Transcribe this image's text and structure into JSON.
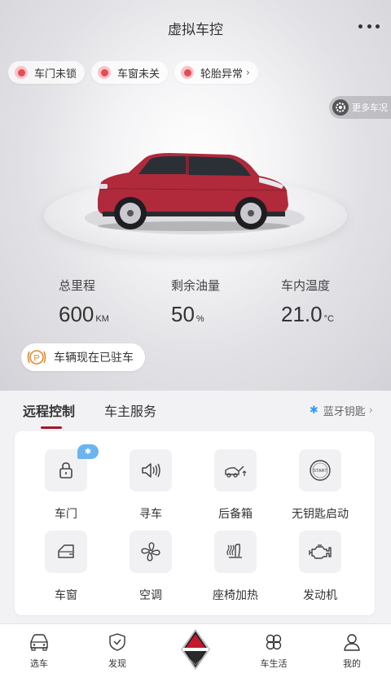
{
  "header": {
    "title": "虚拟车控"
  },
  "alerts": [
    {
      "label": "车门未锁"
    },
    {
      "label": "车窗未关"
    },
    {
      "label": "轮胎异常",
      "chevron": "›"
    }
  ],
  "more_status": {
    "label": "更多车况"
  },
  "stats": [
    {
      "label": "总里程",
      "value": "600",
      "unit": "KM"
    },
    {
      "label": "剩余油量",
      "value": "50",
      "unit": "%"
    },
    {
      "label": "车内温度",
      "value": "21.0",
      "unit": "°C"
    }
  ],
  "parking": {
    "label": "车辆现在已驻车",
    "icon": "parking-brake-icon"
  },
  "tabs": [
    {
      "label": "远程控制"
    },
    {
      "label": "车主服务"
    }
  ],
  "bluetooth_key": {
    "label": "蓝牙钥匙",
    "chevron": "›"
  },
  "controls": [
    {
      "label": "车门",
      "icon": "lock-icon",
      "badge": "bluetooth"
    },
    {
      "label": "寻车",
      "icon": "horn-icon"
    },
    {
      "label": "后备箱",
      "icon": "trunk-icon"
    },
    {
      "label": "无钥匙启动",
      "icon": "start-button-icon",
      "icon_text": "START"
    },
    {
      "label": "车窗",
      "icon": "window-icon"
    },
    {
      "label": "空调",
      "icon": "fan-icon"
    },
    {
      "label": "座椅加热",
      "icon": "seat-heat-icon"
    },
    {
      "label": "发动机",
      "icon": "engine-icon"
    }
  ],
  "bottom_nav": [
    {
      "label": "选车",
      "icon": "car-icon"
    },
    {
      "label": "发现",
      "icon": "shield-check-icon"
    },
    {
      "label": "",
      "icon": "brand-logo"
    },
    {
      "label": "车生活",
      "icon": "clover-icon"
    },
    {
      "label": "我的",
      "icon": "person-icon"
    }
  ],
  "colors": {
    "accent": "#a0182a",
    "alert": "#e64b55",
    "bluetooth": "#3c9be8",
    "car_body": "#b02a3c"
  }
}
